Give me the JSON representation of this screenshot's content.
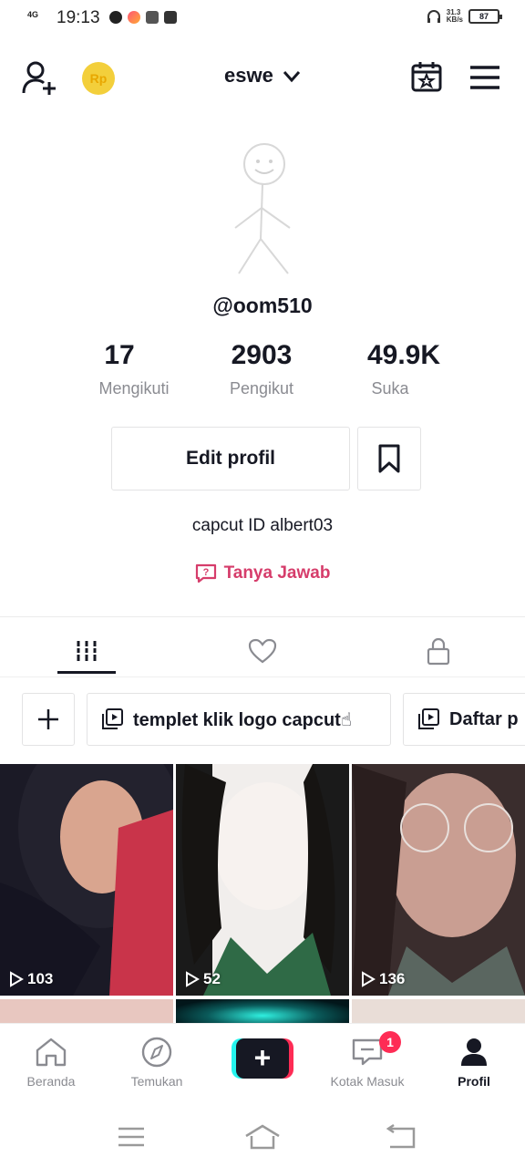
{
  "status_bar": {
    "network": "4G",
    "time": "19:13",
    "speed": "31.3\nKB/s",
    "battery": "87"
  },
  "header": {
    "username": "eswe",
    "coin_label": "Rp"
  },
  "profile": {
    "handle": "@oom510",
    "stats": [
      {
        "value": "17",
        "label": "Mengikuti"
      },
      {
        "value": "2903",
        "label": "Pengikut"
      },
      {
        "value": "49.9K",
        "label": "Suka"
      }
    ],
    "edit_button": "Edit profil",
    "bio": "capcut ID albert03",
    "qa_link": "Tanya Jawab"
  },
  "playlists": [
    {
      "label": "templet klik logo capcut☝"
    },
    {
      "label": "Daftar p"
    }
  ],
  "videos": [
    {
      "views": "103"
    },
    {
      "views": "52"
    },
    {
      "views": "136"
    }
  ],
  "bottom_nav": {
    "items": [
      {
        "label": "Beranda"
      },
      {
        "label": "Temukan"
      },
      {
        "label": "Kotak Masuk"
      },
      {
        "label": "Profil"
      }
    ],
    "inbox_badge": "1"
  },
  "colors": {
    "accent_pink": "#d63d6b",
    "tiktok_red": "#fe2c55",
    "tiktok_cyan": "#25f4ee",
    "coin_yellow": "#f3cf3b"
  }
}
